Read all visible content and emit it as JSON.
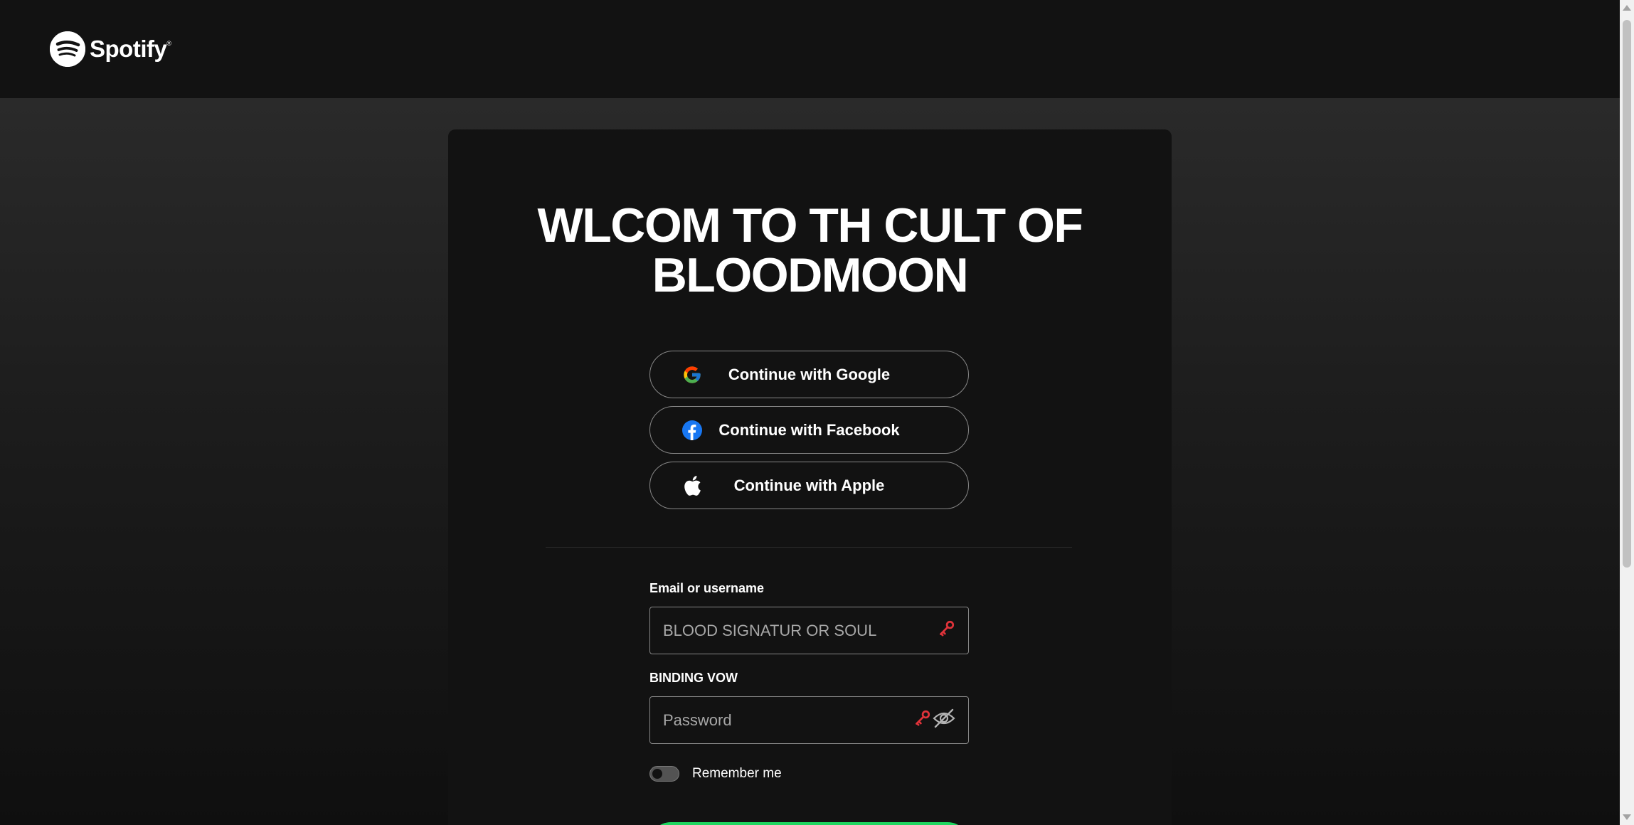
{
  "header": {
    "logo_text": "Spotify",
    "logo_mark": "®",
    "logo_icon": "spotify-icon"
  },
  "login": {
    "title": "WLCOM TO TH CULT OF BLOODMOON",
    "providers": [
      {
        "label": "Continue with Google",
        "icon": "google-icon"
      },
      {
        "label": "Continue with Facebook",
        "icon": "facebook-icon"
      },
      {
        "label": "Continue with Apple",
        "icon": "apple-icon"
      }
    ],
    "email_label": "Email or username",
    "email_placeholder": "BLOOD SIGNATUR OR SOUL",
    "password_label": "BINDING VOW",
    "password_placeholder": "Password",
    "remember_label": "Remember me",
    "remember_checked": false
  },
  "colors": {
    "accent": "#1ed760",
    "key_icon": "#e0333a"
  }
}
